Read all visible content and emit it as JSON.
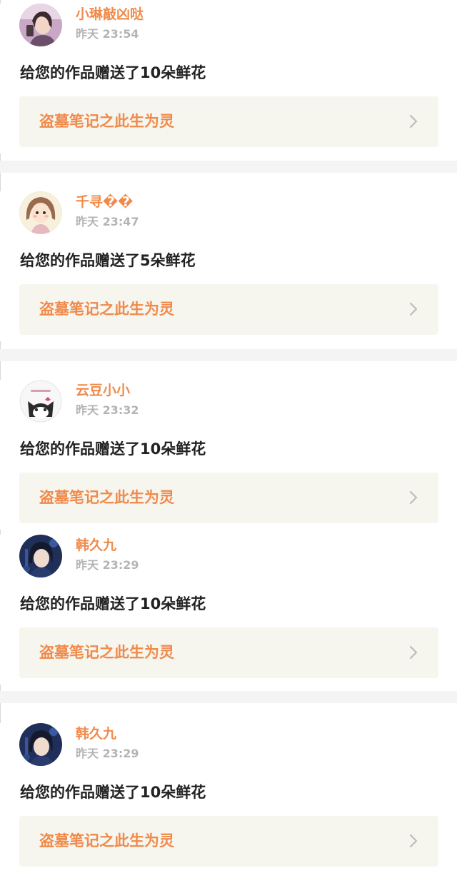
{
  "notifications": [
    {
      "username": "小琳敲凶哒",
      "time": "昨天 23:54",
      "message": "给您的作品赠送了10朵鲜花",
      "work_title": "盗墓笔记之此生为灵"
    },
    {
      "username": "千寻��",
      "time": "昨天 23:47",
      "message": "给您的作品赠送了5朵鲜花",
      "work_title": "盗墓笔记之此生为灵"
    },
    {
      "username": "云豆小小",
      "time": "昨天 23:32",
      "message": "给您的作品赠送了10朵鲜花",
      "work_title": "盗墓笔记之此生为灵"
    },
    {
      "username": "韩久九",
      "time": "昨天 23:29",
      "message": "给您的作品赠送了10朵鲜花",
      "work_title": "盗墓笔记之此生为灵"
    },
    {
      "username": "韩久九",
      "time": "昨天 23:29",
      "message": "给您的作品赠送了10朵鲜花",
      "work_title": "盗墓笔记之此生为灵"
    }
  ],
  "icons": {
    "chevron": "chevron-right-icon",
    "avatar": "user-avatar"
  },
  "colors": {
    "accent": "#f08a4b",
    "card_background": "#f6f5ee",
    "divider": "#f4f4f4",
    "timestamp": "#b4b4b4",
    "text": "#222222"
  }
}
